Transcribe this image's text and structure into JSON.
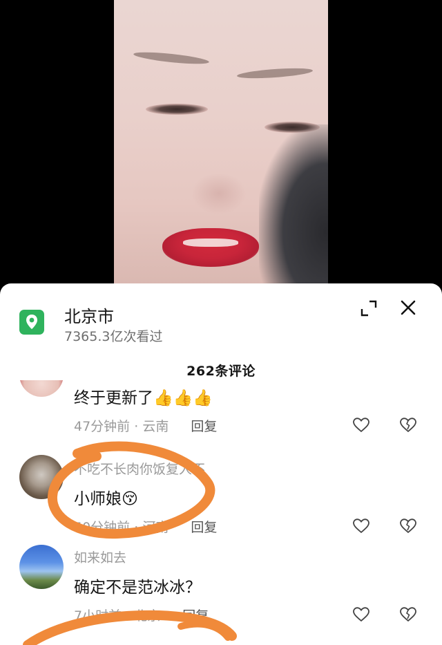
{
  "location": {
    "name": "北京市",
    "views": "7365.3亿次看过"
  },
  "comments_header": "262条评论",
  "comments": [
    {
      "username": "",
      "text": "终于更新了",
      "emoji": "👍👍👍",
      "time": "47分钟前",
      "region": "云南",
      "reply_label": "回复"
    },
    {
      "username": "不吃不长肉你饭复人不",
      "text": "小师娘",
      "emoji": "😚",
      "time": "50分钟前",
      "region": "河南",
      "reply_label": "回复"
    },
    {
      "username": "如来如去",
      "text": "确定不是范冰冰？",
      "emoji": "",
      "time": "7小时前",
      "region": "北京",
      "reply_label": "回复"
    }
  ],
  "icons": {
    "location": "map-pin-icon",
    "expand": "expand-icon",
    "close": "close-icon",
    "like": "heart-icon",
    "dislike": "broken-heart-icon"
  },
  "colors": {
    "accent_green": "#2fb35d",
    "annotation_orange": "#f08a3a",
    "sheet_bg": "#ffffff"
  }
}
